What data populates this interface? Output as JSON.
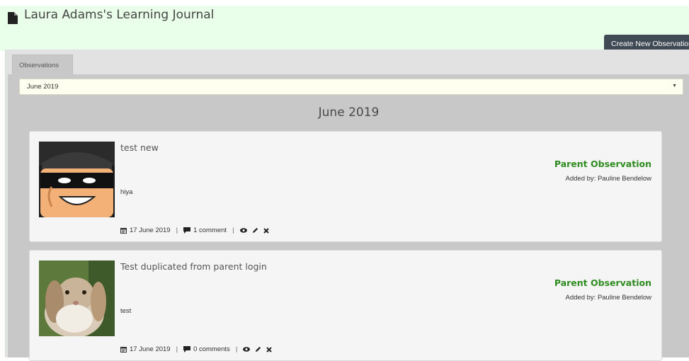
{
  "header": {
    "title": "Laura Adams's Learning Journal",
    "create_button": "Create New Observation"
  },
  "tabs": [
    {
      "label": "Observations",
      "active": true
    }
  ],
  "filter": {
    "selected_month": "June 2019"
  },
  "month_heading": "June 2019",
  "observations": [
    {
      "title": "test new",
      "description": "hiya",
      "type": "Parent Observation",
      "added_by": "Added by: Pauline Bendelow",
      "date": "17 June 2019",
      "comments": "1 comment",
      "image": "lego-figure-image"
    },
    {
      "title": "Test duplicated from parent login",
      "description": "test",
      "type": "Parent Observation",
      "added_by": "Added by: Pauline Bendelow",
      "date": "17 June 2019",
      "comments": "0 comments",
      "image": "rabbit-image"
    }
  ],
  "colors": {
    "header_bg": "#eaffea",
    "observation_type": "#2e8b1f",
    "button_bg": "#3f4a55"
  },
  "icons": [
    "document-icon",
    "calendar-icon",
    "comment-icon",
    "view-icon",
    "edit-icon",
    "delete-icon",
    "dropdown-arrow-icon"
  ]
}
